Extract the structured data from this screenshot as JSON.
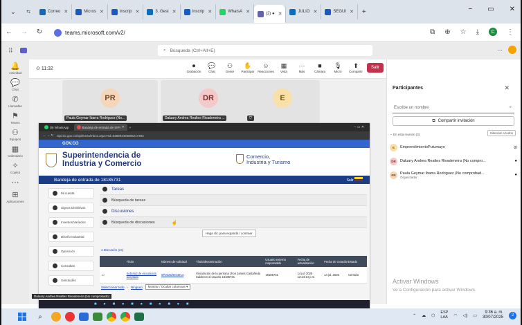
{
  "browser": {
    "tabs": [
      {
        "label": "Correo",
        "color": "#0f6cbd"
      },
      {
        "label": "Micros",
        "color": "#185abd"
      },
      {
        "label": "Inscrip",
        "color": "#185abd"
      },
      {
        "label": "3. Gest",
        "color": "#0f6cbd"
      },
      {
        "label": "Inscrip",
        "color": "#185abd"
      },
      {
        "label": "WhatsA",
        "color": "#25d366"
      },
      {
        "label": "(2) ●",
        "color": "#6264a7"
      },
      {
        "label": "JULIO",
        "color": "#0f6cbd"
      },
      {
        "label": "SEGUI",
        "color": "#185abd"
      }
    ],
    "new_tab": "+",
    "url": "teams.microsoft.com/v2/"
  },
  "teams": {
    "search_placeholder": "Búsqueda (Ctrl+Alt+E)",
    "rail": [
      {
        "label": "Actividad",
        "icon": "bell-icon"
      },
      {
        "label": "Chat",
        "icon": "chat-icon"
      },
      {
        "label": "Llamadas",
        "icon": "phone-icon"
      },
      {
        "label": "Teams",
        "icon": "teams-icon"
      },
      {
        "label": "Equipos",
        "icon": "people-icon"
      },
      {
        "label": "Calendario",
        "icon": "calendar-icon"
      },
      {
        "label": "Copilot",
        "icon": "copilot-icon"
      },
      {
        "label": "",
        "icon": "more-icon"
      },
      {
        "label": "Aplicaciones",
        "icon": "apps-icon"
      }
    ],
    "meeting": {
      "timer": "11:32",
      "tools": [
        "Grabación",
        "Chat",
        "Gente",
        "Participar",
        "Reacciones",
        "Vista",
        "Más",
        "Cámara",
        "Micró",
        "Compartir"
      ],
      "leave": "Salir",
      "tiles": [
        {
          "initials": "PR",
          "name": "Paula Geymar Ibarra Rodriguez (No...",
          "color": "#f6d6b8",
          "fg": "#6a4a2a"
        },
        {
          "initials": "DR",
          "name": "Daluary Andrea Realtes Rivadeneira ...",
          "color": "#f3c9c9",
          "fg": "#7a3030"
        },
        {
          "initials": "E",
          "name": "",
          "color": "#f9e0a8",
          "fg": "#7a5a10"
        }
      ]
    },
    "participants": {
      "title": "Participantes",
      "search_placeholder": "Escribe un nombre",
      "invite": "Compartir invitación",
      "section": "En esta reunión (3)",
      "mute_all": "Silenciar a todos",
      "people": [
        {
          "initials": "E",
          "name": "EmprendimientoPutumayo",
          "role": "",
          "color": "#f9e0a8",
          "fg": "#7a5a10"
        },
        {
          "initials": "DR",
          "name": "Daluary Andrea Realtes Rivadeneira (No compro...",
          "role": "",
          "color": "#f3c9c9",
          "fg": "#7a3030"
        },
        {
          "initials": "PR",
          "name": "Paula Geymar Ibarra Rodriguez (No comprobad...",
          "role": "Organizador",
          "color": "#f6d6b8",
          "fg": "#6a4a2a"
        }
      ],
      "activate_title": "Activar Windows",
      "activate_sub": "Ve a Configuración para activar Windows."
    }
  },
  "shared": {
    "tabs": [
      "(9) WhatsApp",
      "Bandeja de entrada de SIPI"
    ],
    "url": "sipi.sic.gov.co/sipi/Extra/Inbox.aspx?sd=638894465805217393",
    "gov": "GOV.CO",
    "sic_title_1": "Superintendencia de",
    "sic_title_2": "Industria y Comercio",
    "mincom_1": "Comercio,",
    "mincom_2": "Industria y Turismo",
    "bandeja": "Bandeja de entrada de 18185731",
    "salir": "Salir",
    "menu": [
      "Mi cuenta",
      "Signos Distintivos",
      "Inventos/Variados",
      "Diseño Industrial",
      "Oposición",
      "Consultas",
      "Solicitudes"
    ],
    "sections": {
      "tareas": "Tareas",
      "busq_tareas": "Búsqueda de tareas",
      "discusiones": "Discusiones",
      "busq_disc": "Búsqueda de discusiones",
      "tooltip": "Haga clic para expandir / contraer",
      "count": "1 Discusión (es)"
    },
    "table": {
      "headers": [
        "Título",
        "Número de solicitud",
        "Título/denominación",
        "Usuario externo responsable",
        "Fecha de actualización",
        "Fecha de creación",
        "Estado"
      ],
      "row": {
        "titulo": "Solicitud de vinculación aceptada",
        "numero": "SP2025/0044914",
        "denominacion": "Vinculación de la persona Jhon James Castañeda Calderon al usuario 18185731",
        "usuario": "18185731",
        "fecha_act": "14 jul. 2025 12:14:14 p.m.",
        "fecha_cre": "14 jul. 2025",
        "estado": "Cerrado"
      },
      "footer_select": "Seleccionar todo",
      "footer_none": "Ninguno",
      "footer_show": "Mostrar / Ocultar columnas ▾"
    },
    "presenter": "Daluary Andrea Realtes Rivadeneira (No comprobado)"
  },
  "taskbar": {
    "lang": "ESP",
    "lang2": "LAA",
    "time": "9:36 a. m.",
    "date": "30/07/2025"
  }
}
